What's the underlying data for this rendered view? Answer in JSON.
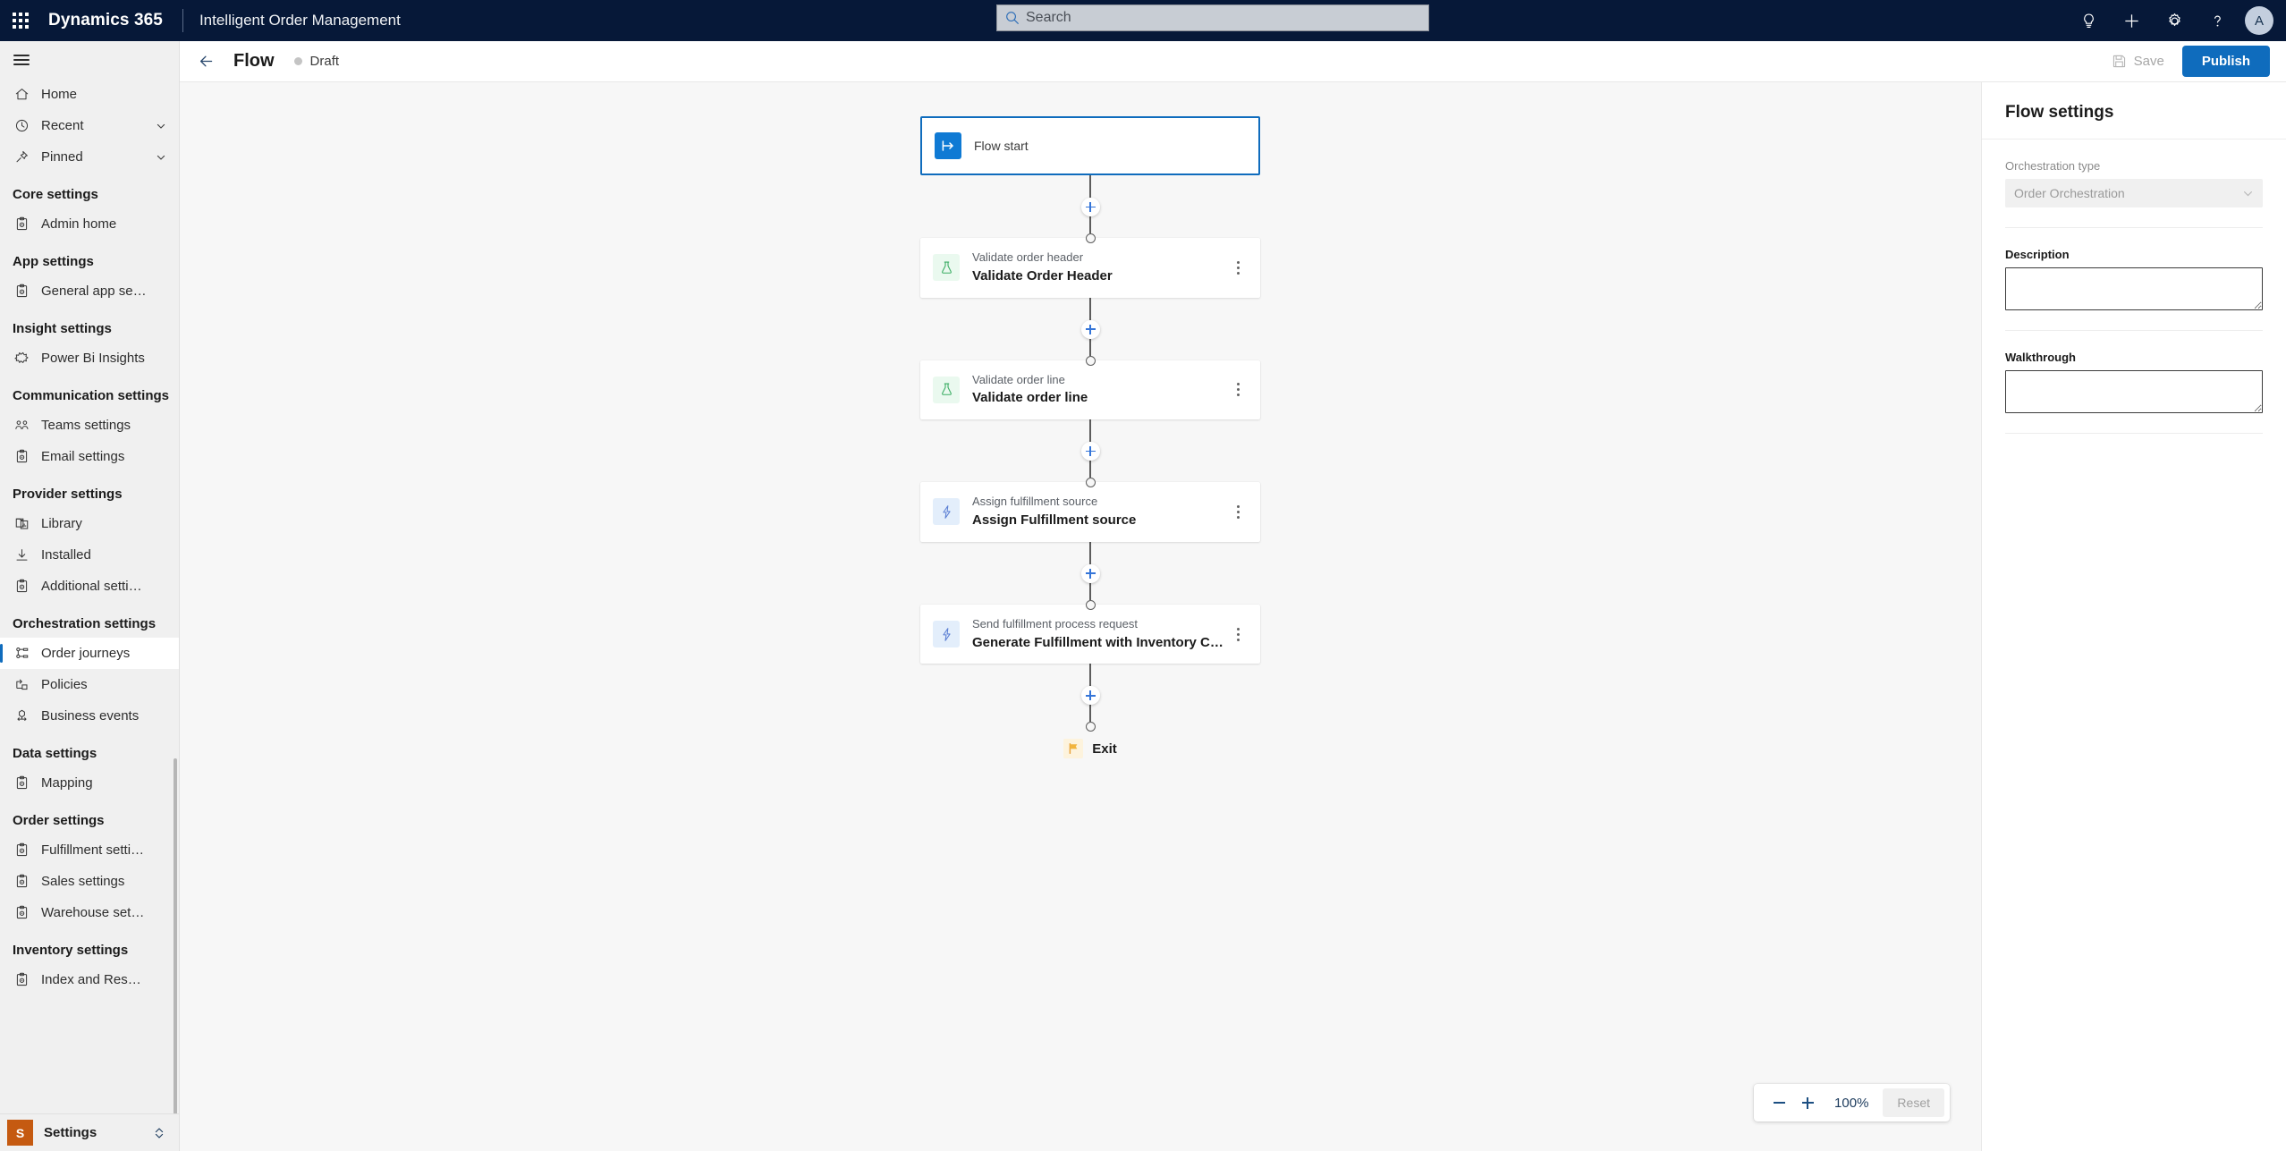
{
  "suitebar": {
    "waffle_label": "App launcher",
    "brand": "Dynamics 365",
    "app_name": "Intelligent Order Management",
    "search": {
      "placeholder": "Search",
      "value": ""
    },
    "actions": [
      {
        "name": "lightbulb-icon",
        "label": "Insights"
      },
      {
        "name": "plus-icon",
        "label": "New"
      },
      {
        "name": "gear-icon",
        "label": "Settings"
      },
      {
        "name": "question-icon",
        "label": "Help"
      }
    ],
    "avatar_initial": "A"
  },
  "sidebar": {
    "hamburger_label": "Expand / collapse site map",
    "quick": [
      {
        "label": "Home",
        "icon": "home-icon",
        "expandable": false
      },
      {
        "label": "Recent",
        "icon": "clock-icon",
        "expandable": true
      },
      {
        "label": "Pinned",
        "icon": "pin-icon",
        "expandable": true
      }
    ],
    "groups": [
      {
        "title": "Core settings",
        "items": [
          {
            "label": "Admin home",
            "icon": "clipboard-gear-icon"
          }
        ]
      },
      {
        "title": "App settings",
        "items": [
          {
            "label": "General app setti...",
            "icon": "clipboard-gear-icon"
          }
        ]
      },
      {
        "title": "Insight settings",
        "items": [
          {
            "label": "Power Bi Insights",
            "icon": "puzzle-icon"
          }
        ]
      },
      {
        "title": "Communication settings",
        "items": [
          {
            "label": "Teams settings",
            "icon": "people-icon"
          },
          {
            "label": "Email settings",
            "icon": "clipboard-gear-icon"
          }
        ]
      },
      {
        "title": "Provider settings",
        "items": [
          {
            "label": "Library",
            "icon": "library-icon"
          },
          {
            "label": "Installed",
            "icon": "download-icon"
          },
          {
            "label": "Additional settings",
            "icon": "clipboard-gear-icon"
          }
        ]
      },
      {
        "title": "Orchestration settings",
        "items": [
          {
            "label": "Order journeys",
            "icon": "sitemap-icon",
            "selected": true
          },
          {
            "label": "Policies",
            "icon": "flow-arrow-icon"
          },
          {
            "label": "Business events",
            "icon": "event-share-icon"
          }
        ]
      },
      {
        "title": "Data settings",
        "items": [
          {
            "label": "Mapping",
            "icon": "clipboard-gear-icon"
          }
        ]
      },
      {
        "title": "Order settings",
        "items": [
          {
            "label": "Fulfillment settings",
            "icon": "clipboard-gear-icon"
          },
          {
            "label": "Sales settings",
            "icon": "clipboard-gear-icon"
          },
          {
            "label": "Warehouse settings",
            "icon": "clipboard-gear-icon"
          }
        ]
      },
      {
        "title": "Inventory settings",
        "items": [
          {
            "label": "Index and Reserva...",
            "icon": "clipboard-gear-icon"
          }
        ]
      }
    ],
    "footer": {
      "badge": "S",
      "label": "Settings"
    }
  },
  "commandbar": {
    "back_label": "Back",
    "title": "Flow",
    "status": "Draft",
    "status_color": "#c4c4c4",
    "save_label": "Save",
    "save_disabled": true,
    "publish_label": "Publish",
    "publish_color": "#0f6cbd"
  },
  "flow": {
    "start": {
      "sub": "",
      "title": "Flow start",
      "icon": "flow-start-icon",
      "selected": true
    },
    "steps": [
      {
        "sub": "Validate order header",
        "title": "Validate Order Header",
        "icon": "flask-icon",
        "icon_style": "green"
      },
      {
        "sub": "Validate order line",
        "title": "Validate order line",
        "icon": "flask-icon",
        "icon_style": "green"
      },
      {
        "sub": "Assign fulfillment source",
        "title": "Assign Fulfillment source",
        "icon": "lightning-icon",
        "icon_style": "blue"
      },
      {
        "sub": "Send fulfillment process request",
        "title": "Generate Fulfillment with Inventory Check",
        "icon": "lightning-icon",
        "icon_style": "blue"
      }
    ],
    "exit": {
      "label": "Exit",
      "icon": "flag-icon"
    },
    "add_step_label": "Add a step"
  },
  "zoomctl": {
    "zoom_out_label": "Zoom out",
    "zoom_in_label": "Zoom in",
    "level": "100%",
    "reset_label": "Reset",
    "reset_disabled": true
  },
  "rightpanel": {
    "title": "Flow settings",
    "orchestration_type": {
      "label": "Orchestration type",
      "value": "Order Orchestration",
      "disabled": true
    },
    "description": {
      "label": "Description",
      "value": "",
      "placeholder": ""
    },
    "walkthrough": {
      "label": "Walkthrough",
      "value": "",
      "placeholder": ""
    }
  }
}
